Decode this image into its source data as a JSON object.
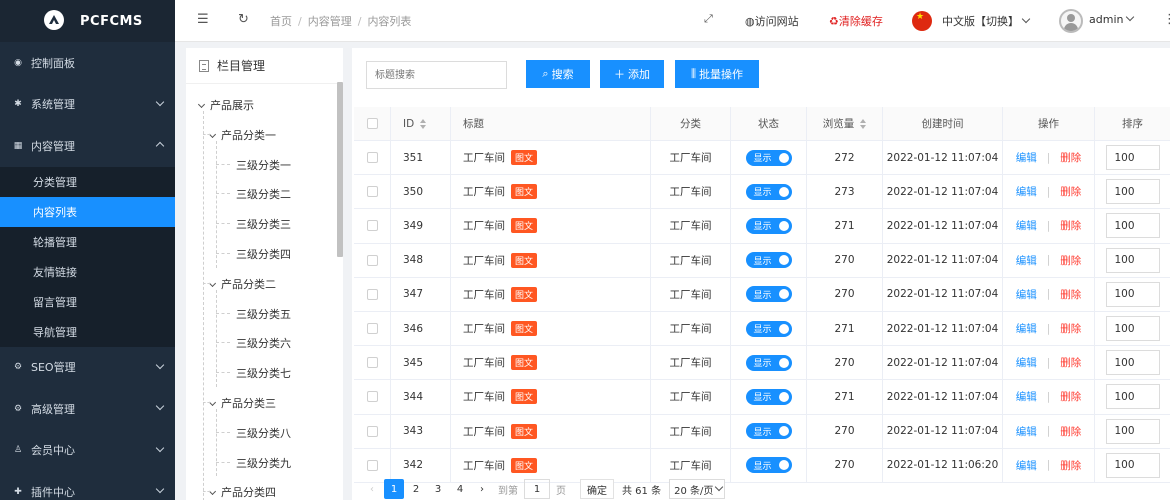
{
  "app": {
    "name": "PCFCMS"
  },
  "sidebar": {
    "items": [
      {
        "label": "控制面板",
        "icon": "dashboard-icon",
        "chevron": ""
      },
      {
        "label": "系统管理",
        "icon": "gear-icon",
        "chevron": "down"
      },
      {
        "label": "内容管理",
        "icon": "content-icon",
        "chevron": "up"
      },
      {
        "label": "SEO管理",
        "icon": "seo-icon",
        "chevron": "down"
      },
      {
        "label": "高级管理",
        "icon": "advanced-icon",
        "chevron": "down"
      },
      {
        "label": "会员中心",
        "icon": "user-icon",
        "chevron": "down"
      },
      {
        "label": "插件中心",
        "icon": "plugin-icon",
        "chevron": "down"
      }
    ],
    "content_sub": [
      {
        "label": "分类管理",
        "active": false
      },
      {
        "label": "内容列表",
        "active": true
      },
      {
        "label": "轮播管理",
        "active": false
      },
      {
        "label": "友情链接",
        "active": false
      },
      {
        "label": "留言管理",
        "active": false
      },
      {
        "label": "导航管理",
        "active": false
      }
    ]
  },
  "header": {
    "breadcrumb": [
      "首页",
      "内容管理",
      "内容列表"
    ],
    "visit_site": "访问网站",
    "clear_cache": "清除缓存",
    "language": "中文版【切换】",
    "user": "admin"
  },
  "tree": {
    "title": "栏目管理",
    "root": "产品展示",
    "groups": [
      {
        "name": "产品分类一",
        "children": [
          "三级分类一",
          "三级分类二",
          "三级分类三",
          "三级分类四"
        ]
      },
      {
        "name": "产品分类二",
        "children": [
          "三级分类五",
          "三级分类六",
          "三级分类七"
        ]
      },
      {
        "name": "产品分类三",
        "children": [
          "三级分类八",
          "三级分类九"
        ]
      },
      {
        "name": "产品分类四",
        "children": []
      }
    ]
  },
  "toolbar": {
    "search_placeholder": "标题搜索",
    "search_label": "搜索",
    "add_label": "添加",
    "batch_label": "批量操作"
  },
  "table": {
    "columns": {
      "id": "ID",
      "title": "标题",
      "category": "分类",
      "status": "状态",
      "views": "浏览量",
      "created": "创建时间",
      "actions": "操作",
      "order": "排序"
    },
    "tag_label": "图文",
    "status_label": "显示",
    "edit_label": "编辑",
    "delete_label": "删除",
    "rows": [
      {
        "id": "351",
        "title": "工厂车间",
        "category": "工厂车间",
        "views": "272",
        "created": "2022-01-12 11:07:04",
        "order": "100"
      },
      {
        "id": "350",
        "title": "工厂车间",
        "category": "工厂车间",
        "views": "273",
        "created": "2022-01-12 11:07:04",
        "order": "100"
      },
      {
        "id": "349",
        "title": "工厂车间",
        "category": "工厂车间",
        "views": "271",
        "created": "2022-01-12 11:07:04",
        "order": "100"
      },
      {
        "id": "348",
        "title": "工厂车间",
        "category": "工厂车间",
        "views": "270",
        "created": "2022-01-12 11:07:04",
        "order": "100"
      },
      {
        "id": "347",
        "title": "工厂车间",
        "category": "工厂车间",
        "views": "270",
        "created": "2022-01-12 11:07:04",
        "order": "100"
      },
      {
        "id": "346",
        "title": "工厂车间",
        "category": "工厂车间",
        "views": "271",
        "created": "2022-01-12 11:07:04",
        "order": "100"
      },
      {
        "id": "345",
        "title": "工厂车间",
        "category": "工厂车间",
        "views": "270",
        "created": "2022-01-12 11:07:04",
        "order": "100"
      },
      {
        "id": "344",
        "title": "工厂车间",
        "category": "工厂车间",
        "views": "271",
        "created": "2022-01-12 11:07:04",
        "order": "100"
      },
      {
        "id": "343",
        "title": "工厂车间",
        "category": "工厂车间",
        "views": "270",
        "created": "2022-01-12 11:07:04",
        "order": "100"
      },
      {
        "id": "342",
        "title": "工厂车间",
        "category": "工厂车间",
        "views": "270",
        "created": "2022-01-12 11:06:20",
        "order": "100"
      }
    ]
  },
  "pagination": {
    "pages": [
      "1",
      "2",
      "3",
      "4"
    ],
    "current": "1",
    "goto_label": "到第",
    "goto_value": "1",
    "page_unit": "页",
    "confirm_label": "确定",
    "total": "共 61 条",
    "page_size": "20 条/页"
  },
  "colors": {
    "primary": "#1890ff",
    "sidebar_bg": "#1f2d3d",
    "danger": "#ff3b30",
    "tag": "#ff5722"
  }
}
